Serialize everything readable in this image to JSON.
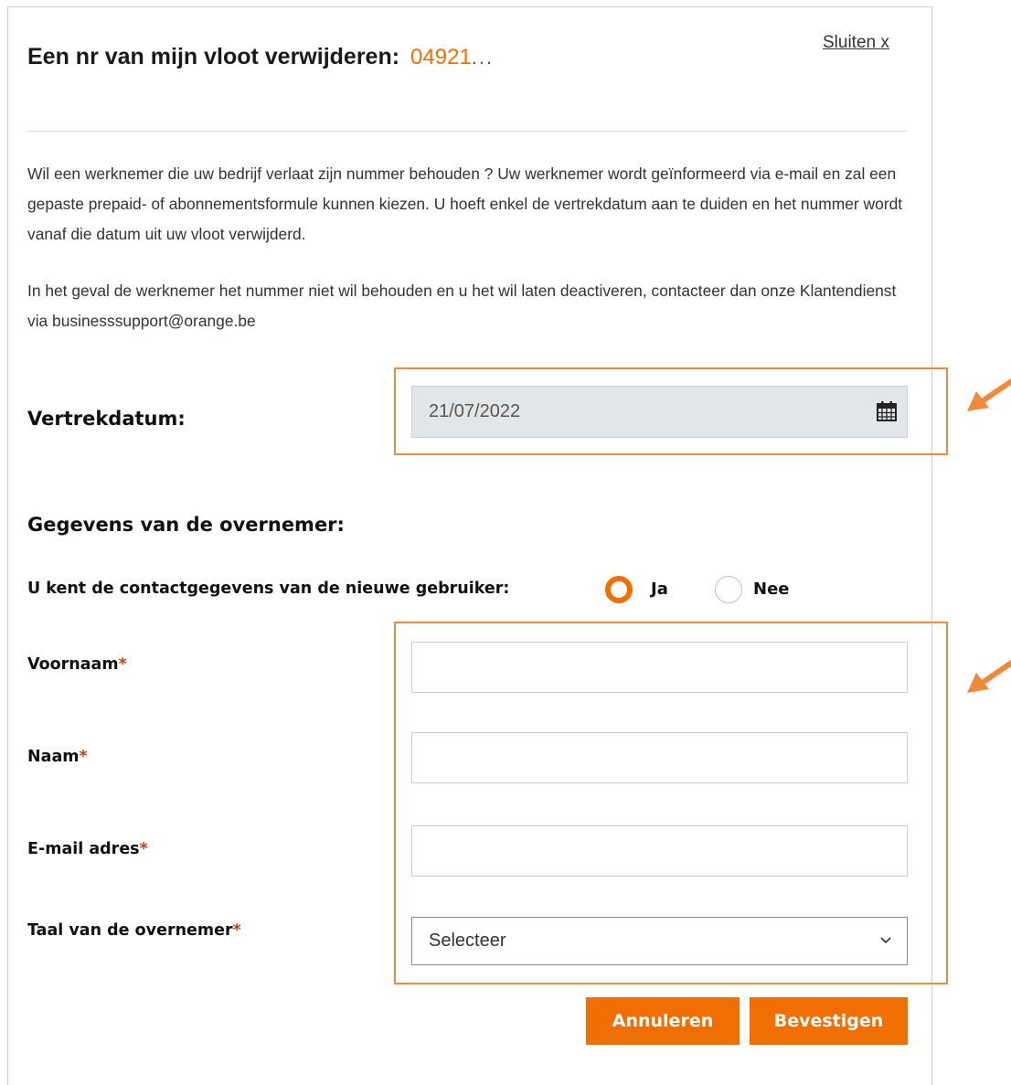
{
  "dialog": {
    "title": "Een nr van mijn vloot verwijderen:",
    "number": "04921",
    "number_mask": "...",
    "close_label": "Sluiten x",
    "paragraph1": "Wil een werknemer die uw bedrijf verlaat zijn nummer behouden ? Uw werknemer wordt geïnformeerd via e-mail en zal een gepaste prepaid- of abonnementsformule kunnen kiezen. U hoeft enkel de vertrekdatum aan te duiden en het nummer wordt vanaf die datum uit uw vloot verwijderd.",
    "paragraph2": "In het geval de werknemer het nummer niet wil behouden en u het wil laten deactiveren, contacteer dan onze Klantendienst via businesssupport@orange.be"
  },
  "departure": {
    "label": "Vertrekdatum:",
    "value": "21/07/2022"
  },
  "successor": {
    "heading": "Gegevens van de overnemer:",
    "contact_question": "U kent de contactgegevens van de nieuwe gebruiker:",
    "option_yes": "Ja",
    "option_no": "Nee",
    "selected": "Ja",
    "required_marker": "*",
    "fields": {
      "firstname_label": "Voornaam",
      "firstname_value": "",
      "lastname_label": "Naam",
      "lastname_value": "",
      "email_label": "E-mail adres",
      "email_value": "",
      "language_label": "Taal van de overnemer",
      "language_value": "Selecteer"
    }
  },
  "actions": {
    "cancel": "Annuleren",
    "confirm": "Bevestigen"
  },
  "colors": {
    "accent": "#f16e00",
    "highlight_border": "#ef8a3a",
    "required": "#cd3c14"
  }
}
